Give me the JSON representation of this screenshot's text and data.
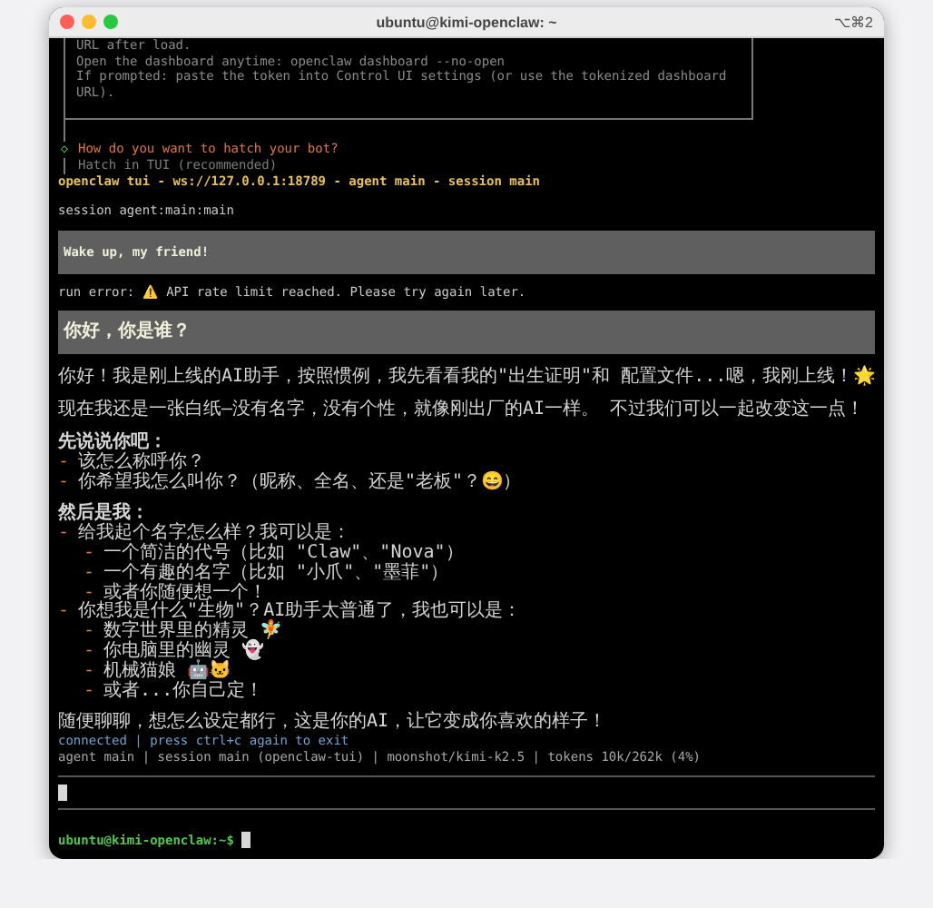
{
  "window": {
    "title": "ubuntu@kimi-openclaw: ~",
    "shortcut": "⌥⌘2"
  },
  "setup_box": {
    "lines": [
      "URL after load.",
      "Open the dashboard anytime: openclaw dashboard --no-open",
      "If prompted: paste the token into Control UI settings (or use the tokenized dashboard",
      "URL)."
    ]
  },
  "prompt": {
    "marker": "◇",
    "question": "How do you want to hatch your bot?",
    "answer": "Hatch in TUI (recommended)"
  },
  "tui_header": "openclaw tui - ws://127.0.0.1:18789 - agent main - session main",
  "session_line": "session agent:main:main",
  "messages": [
    {
      "kind": "user",
      "text": "Wake up, my friend!"
    },
    {
      "kind": "error",
      "text": "run error: ⚠️ API rate limit reached. Please try again later."
    },
    {
      "kind": "user",
      "text": "你好，你是谁？"
    },
    {
      "kind": "assistant",
      "blocks": [
        {
          "kind": "paragraph",
          "text": "你好！我是刚上线的AI助手，按照惯例，我先看看我的\"出生证明\"和 配置文件...嗯，我刚上线！🌟"
        },
        {
          "kind": "paragraph",
          "text": "现在我还是一张白纸—没有名字，没有个性，就像刚出厂的AI一样。 不过我们可以一起改变这一点！"
        },
        {
          "kind": "heading",
          "text": "先说说你吧："
        },
        {
          "kind": "list",
          "items": [
            {
              "marker": "-",
              "text": "该怎么称呼你？"
            },
            {
              "marker": "-",
              "text": "你希望我怎么叫你？（昵称、全名、还是\"老板\"？😄）"
            }
          ]
        },
        {
          "kind": "heading",
          "text": "然后是我："
        },
        {
          "kind": "list",
          "items": [
            {
              "marker": "-",
              "text": "给我起个名字怎么样？我可以是：",
              "children": [
                {
                  "marker": "-",
                  "text": "一个简洁的代号（比如 \"Claw\"、\"Nova\"）"
                },
                {
                  "marker": "-",
                  "text": "一个有趣的名字（比如 \"小爪\"、\"墨菲\"）"
                },
                {
                  "marker": "-",
                  "text": "或者你随便想一个！"
                }
              ]
            },
            {
              "marker": "-",
              "text": "你想我是什么\"生物\"？AI助手太普通了，我也可以是：",
              "children": [
                {
                  "marker": "-",
                  "text": "数字世界里的精灵 🧚"
                },
                {
                  "marker": "-",
                  "text": "你电脑里的幽灵 👻"
                },
                {
                  "marker": "-",
                  "text": "机械猫娘 🤖🐱"
                },
                {
                  "marker": "-",
                  "text": "或者...你自己定！"
                }
              ]
            }
          ]
        },
        {
          "kind": "paragraph",
          "text": "随便聊聊，想怎么设定都行，这是你的AI，让它变成你喜欢的样子！"
        }
      ]
    }
  ],
  "status": {
    "connection": "connected | press ctrl+c again to exit",
    "details": "agent main | session main (openclaw-tui) | moonshot/kimi-k2.5 | tokens 10k/262k (4%)"
  },
  "shell_prompt": "ubuntu@kimi-openclaw:~$"
}
